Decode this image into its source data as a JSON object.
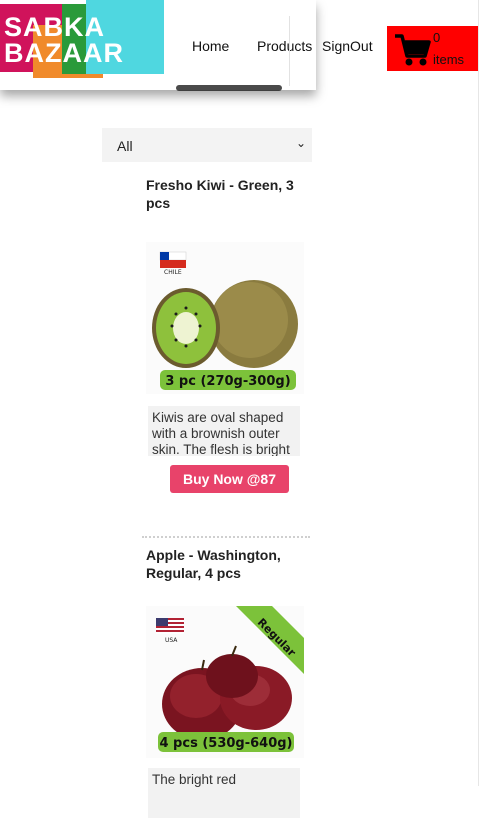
{
  "brand": {
    "line1": "SABKA",
    "line2": "BAZAAR"
  },
  "nav": {
    "home": "Home",
    "products": "Products",
    "signout": "SignOut"
  },
  "cart": {
    "count": "0",
    "items_label": "items"
  },
  "filter": {
    "selected": "All"
  },
  "products": [
    {
      "title": "Fresho Kiwi - Green, 3 pcs",
      "flag_label": "CHILE",
      "pack_label": "3 pc (270g-300g)",
      "description": "Kiwis are oval shaped with a brownish outer skin. The flesh is bright",
      "buy_label": "Buy Now @87"
    },
    {
      "title": "Apple - Washington, Regular, 4 pcs",
      "flag_label": "USA",
      "ribbon": "Regular",
      "pack_label": "4 pcs (530g-640g)",
      "description": "The bright red"
    }
  ],
  "colors": {
    "cart_bg": "#ff0000",
    "buy_button": "#e8436a",
    "pack_badge": "#7cc23a"
  }
}
